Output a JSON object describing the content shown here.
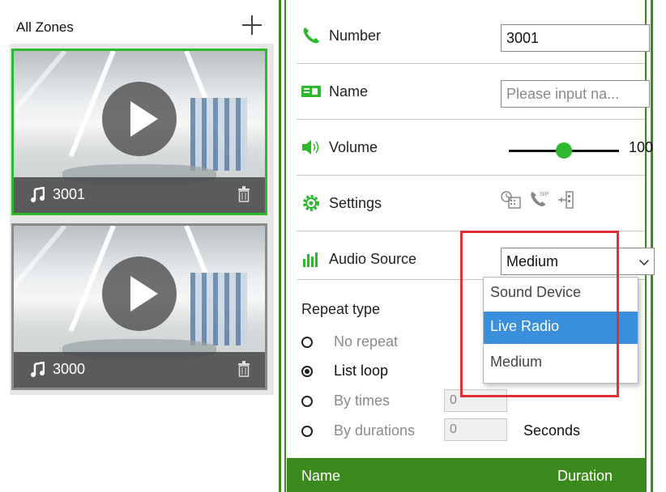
{
  "zones": {
    "title": "All Zones",
    "add_icon": "plus-icon",
    "cards": [
      {
        "number": "3001",
        "selected": true
      },
      {
        "number": "3000",
        "selected": false
      }
    ]
  },
  "settings": {
    "number_label": "Number",
    "number_value": "3001",
    "name_label": "Name",
    "name_placeholder": "Please input na...",
    "volume_label": "Volume",
    "volume_value": "100",
    "volume_level": 0.5,
    "settings_label": "Settings",
    "audio_source_label": "Audio Source",
    "audio_source_value": "Medium"
  },
  "dropdown": {
    "options": [
      "Sound Device",
      "Live Radio",
      "Medium"
    ],
    "highlighted": "Live Radio"
  },
  "repeat": {
    "title": "Repeat type",
    "options": [
      "No repeat",
      "List loop",
      "By times",
      "By durations"
    ],
    "selected": "List loop",
    "times_value": "0",
    "durations_value": "0",
    "seconds_label": "Seconds"
  },
  "list_header": {
    "name": "Name",
    "duration": "Duration"
  },
  "colors": {
    "accent_green": "#3c8a1e",
    "selected_border": "#2eb82e",
    "highlight_blue": "#3a8fdc",
    "annotation_red": "#e0313b"
  }
}
